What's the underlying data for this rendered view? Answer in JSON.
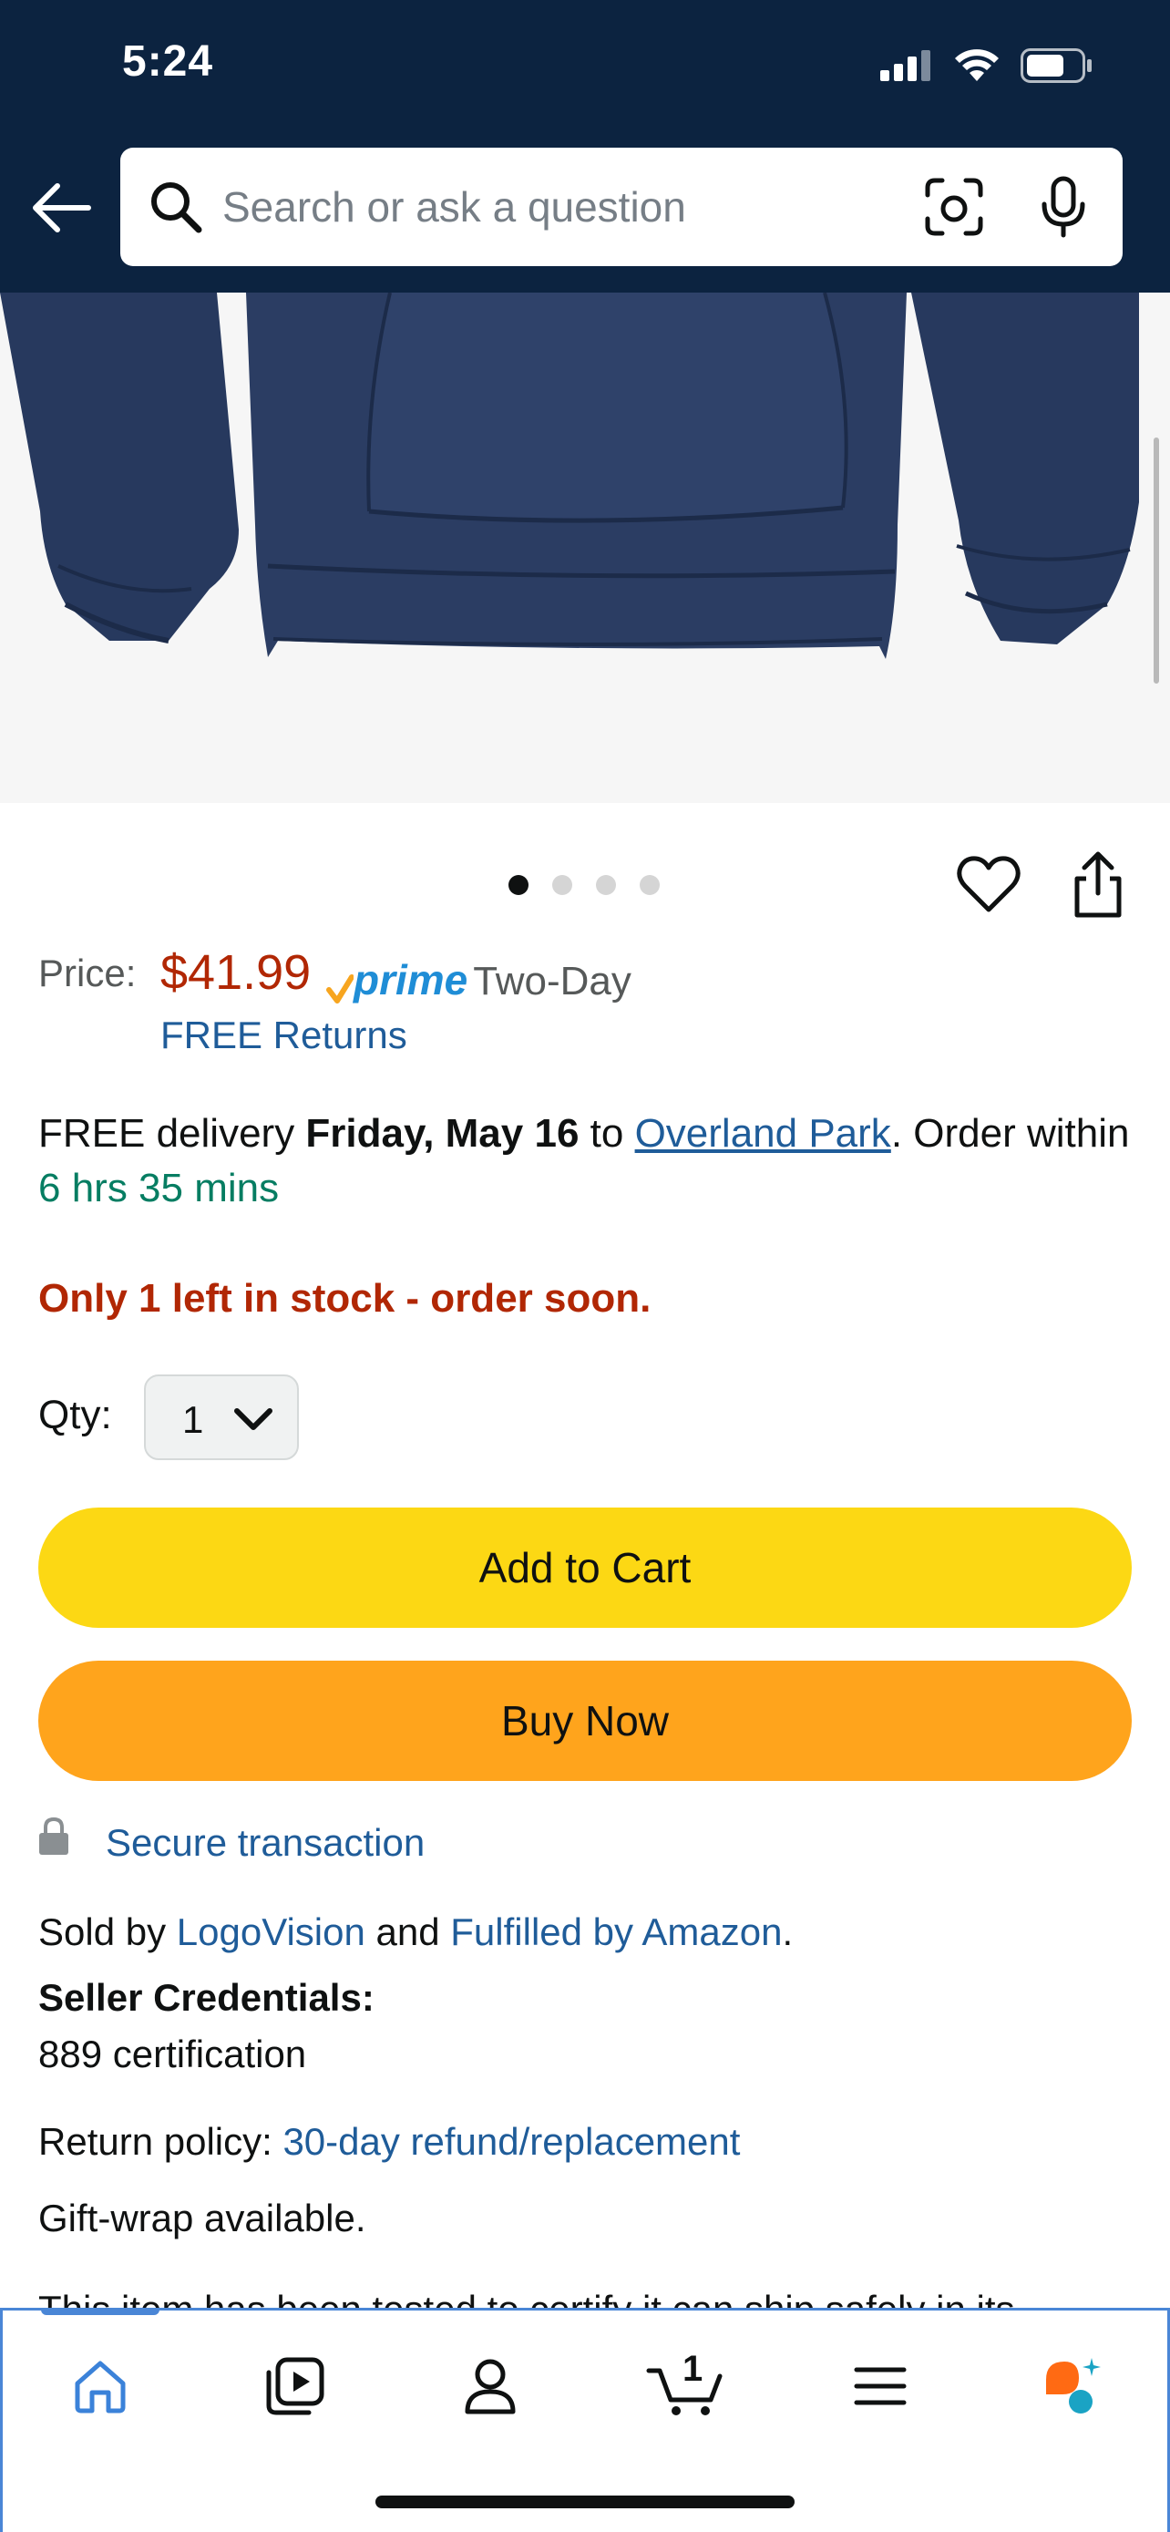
{
  "status_bar": {
    "time": "5:24"
  },
  "search": {
    "placeholder": "Search or ask a question"
  },
  "image_dots": {
    "count": 4,
    "active": 0
  },
  "price": {
    "label": "Price:",
    "value": "$41.99",
    "prime_label": "prime",
    "prime_speed": "Two-Day",
    "returns": "FREE Returns"
  },
  "delivery": {
    "prefix": "FREE delivery ",
    "date": "Friday, May 16",
    "to": " to ",
    "location": "Overland Park",
    "order_within": ". Order within ",
    "countdown": "6 hrs 35 mins"
  },
  "stock": "Only 1 left in stock - order soon.",
  "quantity": {
    "label": "Qty:",
    "value": "1"
  },
  "buttons": {
    "add_to_cart": "Add to Cart",
    "buy_now": "Buy Now"
  },
  "secure": "Secure transaction",
  "seller": {
    "sold_by": "Sold by ",
    "seller_name": "LogoVision",
    "and": " and ",
    "fulfilled": "Fulfilled by Amazon",
    "period": ".",
    "credentials_label": "Seller Credentials:",
    "credentials_value": "889 certification"
  },
  "return_policy": {
    "label": "Return policy: ",
    "link": "30-day refund/replacement"
  },
  "gift_wrap": "Gift-wrap available.",
  "cut_text": "This item has been tested to certify it can ship safely in its",
  "bottom_nav": {
    "cart_count": "1"
  },
  "colors": {
    "header_bg": "#0c2340",
    "price": "#b12704",
    "link": "#1f5c99",
    "add_to_cart": "#fcd814",
    "buy_now": "#ffa41c",
    "countdown": "#067d62",
    "prime": "#1f8dd6"
  },
  "icons": {
    "back": "arrow-left-icon",
    "search": "search-icon",
    "lens": "camera-lens-icon",
    "mic": "microphone-icon",
    "wishlist": "heart-icon",
    "share": "share-icon",
    "lock": "lock-icon",
    "nav": [
      "home-icon",
      "video-icon",
      "account-icon",
      "cart-icon",
      "menu-icon",
      "rufus-icon"
    ]
  }
}
